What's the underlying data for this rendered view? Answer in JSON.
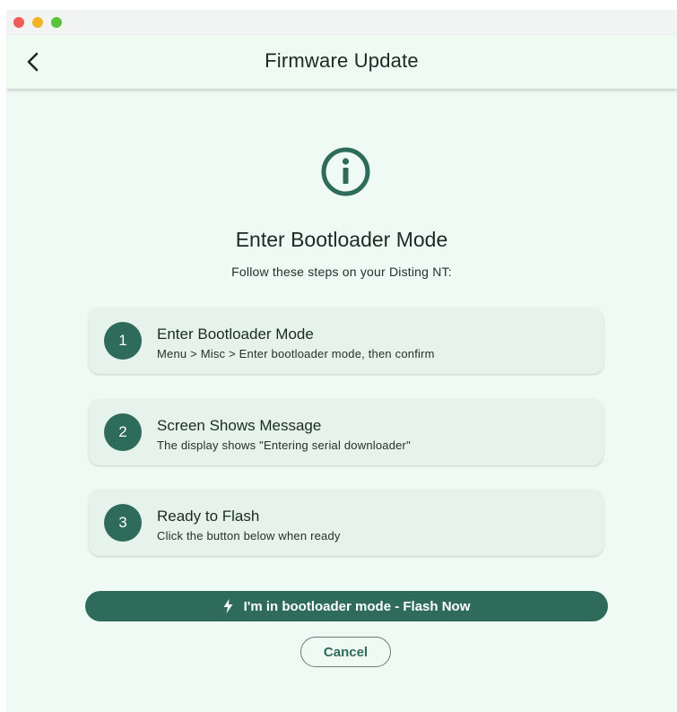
{
  "window": {
    "controls": [
      "close",
      "minimize",
      "zoom"
    ]
  },
  "appbar": {
    "title": "Firmware Update",
    "back_icon": "chevron-left-icon"
  },
  "main": {
    "icon": "info-circle-icon",
    "heading": "Enter Bootloader Mode",
    "subheading": "Follow these steps on your Disting NT:",
    "steps": [
      {
        "number": "1",
        "title": "Enter Bootloader Mode",
        "description": "Menu > Misc > Enter bootloader mode, then confirm"
      },
      {
        "number": "2",
        "title": "Screen Shows Message",
        "description": "The display shows \"Entering serial downloader\""
      },
      {
        "number": "3",
        "title": "Ready to Flash",
        "description": "Click the button below when ready"
      }
    ],
    "primary_button": {
      "label": "I'm in bootloader mode - Flash Now",
      "icon": "lightning-bolt-icon"
    },
    "cancel_button": {
      "label": "Cancel"
    }
  },
  "colors": {
    "accent": "#2f6b5a",
    "background": "#f0faf4",
    "card": "#e6f3ec"
  }
}
